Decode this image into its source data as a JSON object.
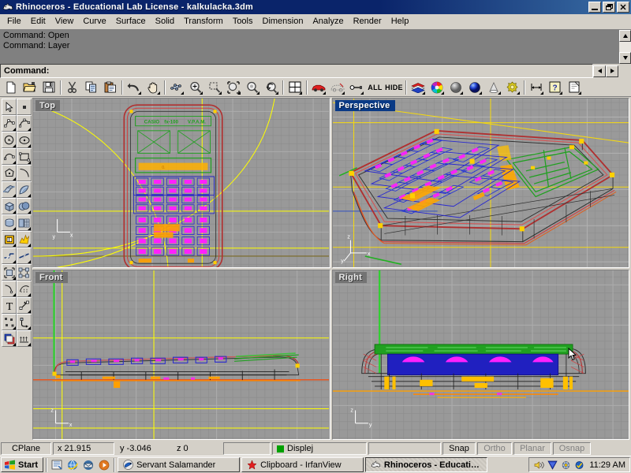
{
  "window": {
    "title": "Rhinoceros - Educational Lab License - kalkulacka.3dm",
    "app_icon": "rhino-icon",
    "buttons": [
      {
        "name": "minimize-button",
        "glyph": "_"
      },
      {
        "name": "restore-button",
        "glyph": "❐"
      },
      {
        "name": "close-button",
        "glyph": "✕"
      }
    ]
  },
  "menubar": {
    "items": [
      {
        "label": "File",
        "name": "menu-file"
      },
      {
        "label": "Edit",
        "name": "menu-edit"
      },
      {
        "label": "View",
        "name": "menu-view"
      },
      {
        "label": "Curve",
        "name": "menu-curve"
      },
      {
        "label": "Surface",
        "name": "menu-surface"
      },
      {
        "label": "Solid",
        "name": "menu-solid"
      },
      {
        "label": "Transform",
        "name": "menu-transform"
      },
      {
        "label": "Tools",
        "name": "menu-tools"
      },
      {
        "label": "Dimension",
        "name": "menu-dimension"
      },
      {
        "label": "Analyze",
        "name": "menu-analyze"
      },
      {
        "label": "Render",
        "name": "menu-render"
      },
      {
        "label": "Help",
        "name": "menu-help"
      }
    ]
  },
  "command_area": {
    "history": [
      "Command: Open",
      "Command: Layer"
    ],
    "prompt": "Command:",
    "input_value": ""
  },
  "toolbar": {
    "buttons": [
      {
        "name": "new-file-icon",
        "tip": "New"
      },
      {
        "name": "open-file-icon",
        "tip": "Open"
      },
      {
        "name": "save-file-icon",
        "tip": "Save"
      },
      {
        "name": "cut-icon",
        "tip": "Cut"
      },
      {
        "name": "copy-icon",
        "tip": "Copy"
      },
      {
        "name": "paste-icon",
        "tip": "Paste"
      },
      {
        "name": "undo-icon",
        "tip": "Undo"
      },
      {
        "name": "pan-hand-icon",
        "tip": "Pan"
      },
      {
        "name": "rotate-view-icon",
        "tip": "Rotate View"
      },
      {
        "name": "zoom-dynamic-icon",
        "tip": "Zoom Dynamic"
      },
      {
        "name": "zoom-window-icon",
        "tip": "Zoom Window"
      },
      {
        "name": "zoom-extents-icon",
        "tip": "Zoom Extents"
      },
      {
        "name": "zoom-selected-icon",
        "tip": "Zoom Selected"
      },
      {
        "name": "zoom-previous-icon",
        "tip": "Zoom Previous"
      },
      {
        "name": "four-view-icon",
        "tip": "4 Viewports"
      },
      {
        "name": "select-object-car-icon",
        "tip": "Select Objects"
      },
      {
        "name": "select-none-car-icon",
        "tip": "Select None"
      },
      {
        "name": "select-point-icon",
        "tip": "Points On"
      },
      {
        "name": "select-all-button",
        "label": "ALL"
      },
      {
        "name": "hide-objects-button",
        "label": "HIDE"
      },
      {
        "name": "layers-icon",
        "tip": "Layers"
      },
      {
        "name": "color-wheel-icon",
        "tip": "Object Color"
      },
      {
        "name": "shaded-view-icon",
        "tip": "Shade"
      },
      {
        "name": "render-sphere-icon",
        "tip": "Render"
      },
      {
        "name": "light-cone-icon",
        "tip": "Spotlight"
      },
      {
        "name": "render-properties-icon",
        "tip": "Render Properties"
      },
      {
        "name": "dimension-icon",
        "tip": "Dimension"
      },
      {
        "name": "help-icon",
        "label": "?"
      },
      {
        "name": "notes-icon",
        "tip": "Notes"
      }
    ]
  },
  "sidebar": {
    "rows": [
      [
        {
          "name": "select-arrow-icon"
        },
        {
          "name": "point-object-icon"
        }
      ],
      [
        {
          "name": "polyline-icon"
        },
        {
          "name": "curve-interpolate-icon"
        }
      ],
      [
        {
          "name": "circle-icon"
        },
        {
          "name": "ellipse-icon"
        }
      ],
      [
        {
          "name": "arc-icon"
        },
        {
          "name": "rectangle-icon"
        }
      ],
      [
        {
          "name": "polygon-icon"
        },
        {
          "name": "fillet-curve-icon"
        }
      ],
      [
        {
          "name": "surface-from-curves-icon"
        },
        {
          "name": "surface-revolve-icon"
        }
      ],
      [
        {
          "name": "box-solid-icon"
        },
        {
          "name": "boolean-union-icon"
        }
      ],
      [
        {
          "name": "revolve-solid-icon"
        },
        {
          "name": "mesh-from-surface-icon"
        }
      ],
      [
        {
          "name": "trim-icon"
        },
        {
          "name": "explode-icon"
        }
      ],
      [
        {
          "name": "split-icon"
        },
        {
          "name": "join-icon"
        }
      ],
      [
        {
          "name": "group-objects-icon"
        },
        {
          "name": "ungroup-objects-icon"
        }
      ],
      [
        {
          "name": "offset-curve-icon"
        },
        {
          "name": "array-curve-icon"
        }
      ],
      [
        {
          "name": "text-tool-icon",
          "label": "T"
        },
        {
          "name": "scale-icon"
        }
      ],
      [
        {
          "name": "control-points-icon"
        },
        {
          "name": "bend-icon"
        }
      ],
      [
        {
          "name": "layer-manager-icon"
        },
        {
          "name": "extrude-icon"
        }
      ]
    ]
  },
  "viewports": [
    {
      "name": "viewport-top",
      "label": "Top",
      "active": false
    },
    {
      "name": "viewport-perspective",
      "label": "Perspective",
      "active": true
    },
    {
      "name": "viewport-front",
      "label": "Front",
      "active": false
    },
    {
      "name": "viewport-right",
      "label": "Right",
      "active": false
    }
  ],
  "statusbar": {
    "cplane_label": "CPlane",
    "coord_x": "x 21.915",
    "coord_y": "y -3.046",
    "coord_z": "z 0",
    "spacer": "",
    "layer_name": "Displej",
    "layer_color": "#00a000",
    "toggles": [
      {
        "label": "Snap",
        "name": "status-snap",
        "enabled": true
      },
      {
        "label": "Ortho",
        "name": "status-ortho",
        "enabled": false
      },
      {
        "label": "Planar",
        "name": "status-planar",
        "enabled": false
      },
      {
        "label": "Osnap",
        "name": "status-osnap",
        "enabled": false
      }
    ]
  },
  "taskbar": {
    "start_label": "Start",
    "quicklaunch": [
      {
        "name": "show-desktop-icon"
      },
      {
        "name": "internet-explorer-icon"
      },
      {
        "name": "outlook-express-icon"
      },
      {
        "name": "media-player-icon"
      }
    ],
    "tasks": [
      {
        "label": "Servant Salamander",
        "name": "taskitem-servant-salamander",
        "icon": "salamander-icon",
        "active": false
      },
      {
        "label": "Clipboard - IrfanView",
        "name": "taskitem-irfanview",
        "icon": "irfanview-icon",
        "active": false
      },
      {
        "label": "Rhinoceros - Educatio...",
        "name": "taskitem-rhinoceros",
        "icon": "rhino-icon",
        "active": true
      }
    ],
    "tray": [
      {
        "name": "volume-icon"
      },
      {
        "name": "network-shield-icon"
      },
      {
        "name": "graphics-driver-icon"
      },
      {
        "name": "antivirus-icon"
      }
    ],
    "clock": "11:29 AM"
  },
  "model": {
    "description": "Calculator (kalkulacka) wireframe model",
    "colors": {
      "keys_blue": "#2020c0",
      "keys_magenta": "#ff00ff",
      "display_green": "#00a000",
      "body_red": "#c02020",
      "accent_orange": "#ffa000",
      "construction_yellow": "#ffff00"
    }
  }
}
